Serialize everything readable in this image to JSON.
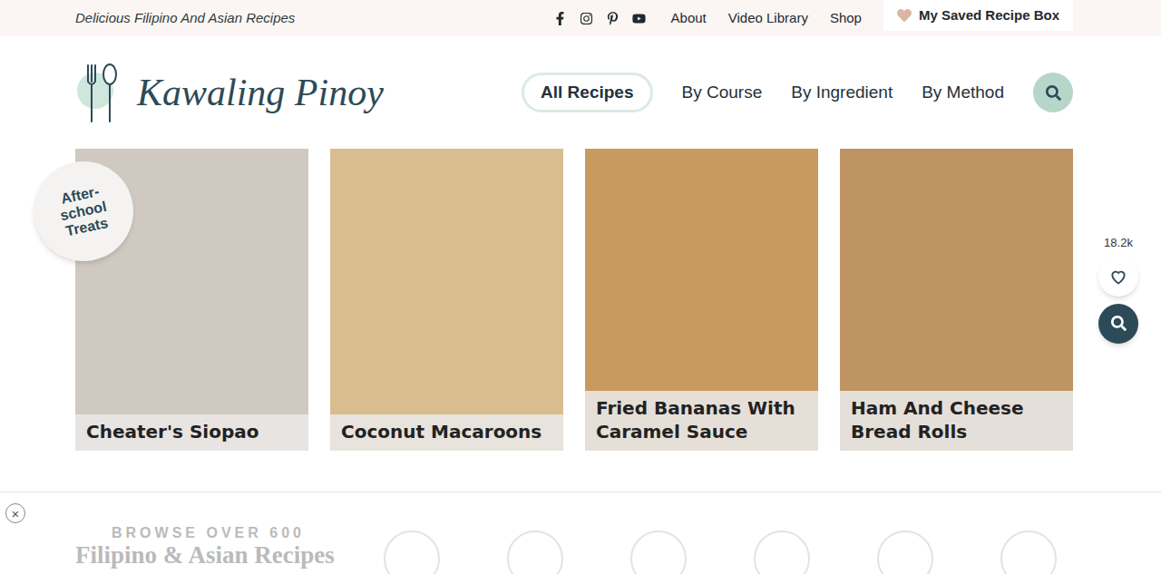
{
  "topbar": {
    "tagline": "Delicious Filipino And Asian Recipes",
    "links": [
      "About",
      "Video Library",
      "Shop"
    ],
    "saved_button": "My Saved Recipe Box"
  },
  "logo": {
    "text": "Kawaling Pinoy"
  },
  "nav": [
    {
      "label": "All Recipes",
      "selected": true
    },
    {
      "label": "By Course",
      "selected": false
    },
    {
      "label": "By Ingredient",
      "selected": false
    },
    {
      "label": "By Method",
      "selected": false
    }
  ],
  "badge": "After-school Treats",
  "cards": [
    {
      "title": "Cheater's Siopao"
    },
    {
      "title": "Coconut Macaroons"
    },
    {
      "title": "Fried Bananas With Caramel Sauce"
    },
    {
      "title": "Ham And Cheese Bread Rolls"
    }
  ],
  "floating": {
    "count": "18.2k"
  },
  "browse": {
    "eyebrow": "BROWSE OVER 600",
    "heading": "Filipino & Asian Recipes",
    "close": "×"
  }
}
